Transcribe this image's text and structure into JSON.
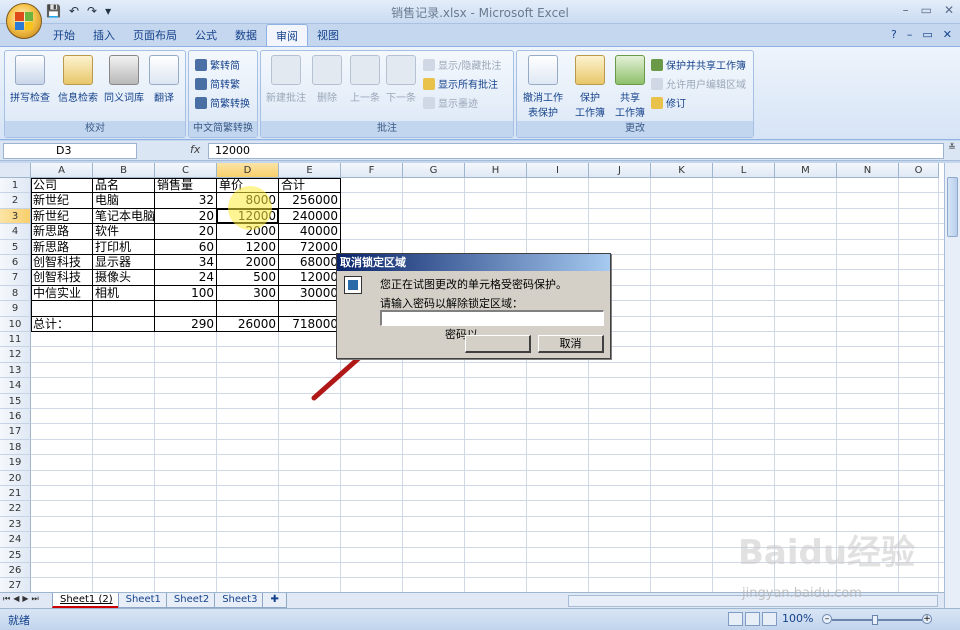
{
  "window": {
    "title": "销售记录.xlsx - Microsoft Excel",
    "controls": [
      "–",
      "▭",
      "✕"
    ]
  },
  "quick_access": {
    "save": "💾",
    "undo": "↶",
    "redo": "↷",
    "customize": "▾"
  },
  "ribbon": {
    "tabs": [
      "开始",
      "插入",
      "页面布局",
      "公式",
      "数据",
      "审阅",
      "视图"
    ],
    "active_tab": "审阅",
    "right_controls": [
      "?",
      "–",
      "▭",
      "✕"
    ],
    "groups": {
      "proofing": {
        "label": "校对",
        "buttons": [
          "拼写检查",
          "信息检索",
          "同义词库",
          "翻译"
        ]
      },
      "chinese": {
        "label": "中文简繁转换",
        "buttons": [
          "繁转简",
          "简转繁",
          "简繁转换"
        ]
      },
      "comments": {
        "label": "批注",
        "buttons": [
          "新建批注",
          "删除",
          "上一条",
          "下一条"
        ],
        "side_buttons": [
          "显示/隐藏批注",
          "显示所有批注",
          "显示墨迹"
        ]
      },
      "changes": {
        "label": "更改",
        "buttons": [
          "撤消工作表保护",
          "保护工作簿",
          "共享工作簿"
        ],
        "big_labels": {
          "unprotect_1": "撤消工作",
          "unprotect_2": "表保护",
          "protect_1": "保护",
          "protect_2": "工作簿",
          "share_1": "共享",
          "share_2": "工作簿"
        },
        "side_buttons": [
          "保护并共享工作簿",
          "允许用户编辑区域",
          "修订"
        ]
      }
    }
  },
  "formula_bar": {
    "name_box": "D3",
    "fx": "fx",
    "content": "12000"
  },
  "grid": {
    "columns": [
      "A",
      "B",
      "C",
      "D",
      "E",
      "F",
      "G",
      "H",
      "I",
      "J",
      "K",
      "L",
      "M",
      "N",
      "O"
    ],
    "selected_column": "D",
    "selected_row": "3",
    "rows": [
      "1",
      "2",
      "3",
      "4",
      "5",
      "6",
      "7",
      "8",
      "9",
      "10",
      "11",
      "12",
      "13",
      "14",
      "15",
      "16",
      "17",
      "18",
      "19",
      "20",
      "21",
      "22",
      "23",
      "24",
      "25",
      "26",
      "27"
    ],
    "cells": [
      [
        "公司",
        "品名",
        "销售量",
        "单价",
        "合计"
      ],
      [
        "新世纪",
        "电脑",
        "32",
        "8000",
        "256000"
      ],
      [
        "新世纪",
        "笔记本电脑",
        "20",
        "12000",
        "240000"
      ],
      [
        "新思路",
        "软件",
        "20",
        "2000",
        "40000"
      ],
      [
        "新思路",
        "打印机",
        "60",
        "1200",
        "72000"
      ],
      [
        "创智科技",
        "显示器",
        "34",
        "2000",
        "68000"
      ],
      [
        "创智科技",
        "摄像头",
        "24",
        "500",
        "12000"
      ],
      [
        "中信实业",
        "相机",
        "100",
        "300",
        "30000"
      ],
      [
        "",
        "",
        "",
        "",
        ""
      ],
      [
        "总计：",
        "",
        "290",
        "26000",
        "718000"
      ]
    ]
  },
  "dialog": {
    "title": "取消锁定区域",
    "message": "您正在试图更改的单元格受密码保护。",
    "prompt": "请输入密码以解除锁定区域：",
    "password_value": "",
    "input_label": "密码以",
    "ok": "",
    "cancel": "取消"
  },
  "sheets": {
    "tabs": [
      "Sheet1 (2)",
      "Sheet1",
      "Sheet2",
      "Sheet3"
    ],
    "active": "Sheet1 (2)"
  },
  "status": {
    "text": "就绪",
    "zoom": "100%"
  },
  "watermark": {
    "main": "Baidu经验",
    "sub": "jingyan.baidu.com"
  }
}
